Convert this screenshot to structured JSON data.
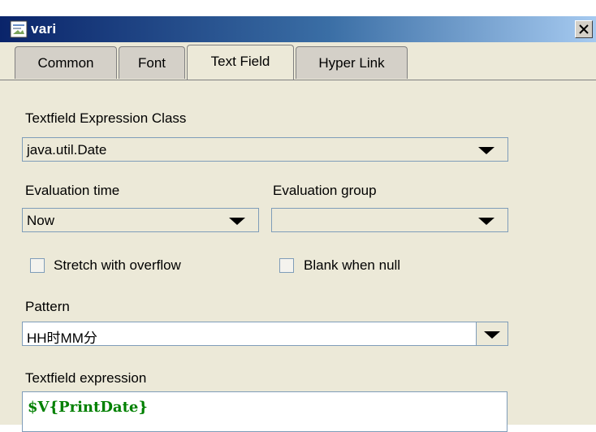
{
  "window": {
    "title": "vari"
  },
  "tabs": [
    {
      "label": "Common"
    },
    {
      "label": "Font"
    },
    {
      "label": "Text Field"
    },
    {
      "label": "Hyper Link"
    }
  ],
  "form": {
    "expression_class_label": "Textfield Expression Class",
    "expression_class_value": "java.util.Date",
    "evaluation_time_label": "Evaluation time",
    "evaluation_time_value": "Now",
    "evaluation_group_label": "Evaluation group",
    "evaluation_group_value": "",
    "stretch_label": "Stretch with overflow",
    "blank_label": "Blank when null",
    "pattern_label": "Pattern",
    "pattern_value": "HH时MM分",
    "expression_label": "Textfield expression",
    "expression_value": "$V{PrintDate}"
  },
  "colors": {
    "titlebar_start": "#0a246a",
    "expression_text": "#008000"
  }
}
